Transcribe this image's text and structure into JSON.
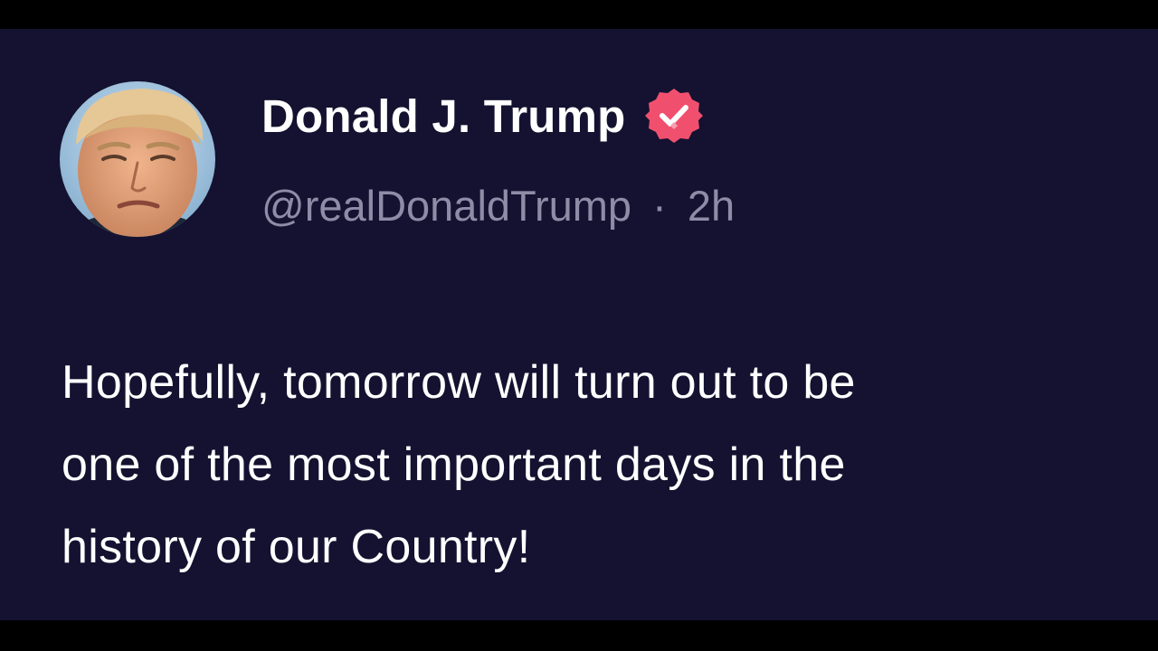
{
  "post": {
    "author": {
      "display_name": "Donald J. Trump",
      "handle": "@realDonaldTrump",
      "verified": true,
      "avatar_icon": "profile-photo"
    },
    "separator": "·",
    "timestamp": "2h",
    "text_lines": [
      "Hopefully, tomorrow will turn out to be",
      "one of the most important days in the",
      "history of our Country!"
    ]
  },
  "colors": {
    "background": "#141230",
    "letterbox": "#000000",
    "name": "#ffffff",
    "handle": "#8e8ca6",
    "body_text": "#ffffff",
    "verified_badge": "#f0506e"
  }
}
